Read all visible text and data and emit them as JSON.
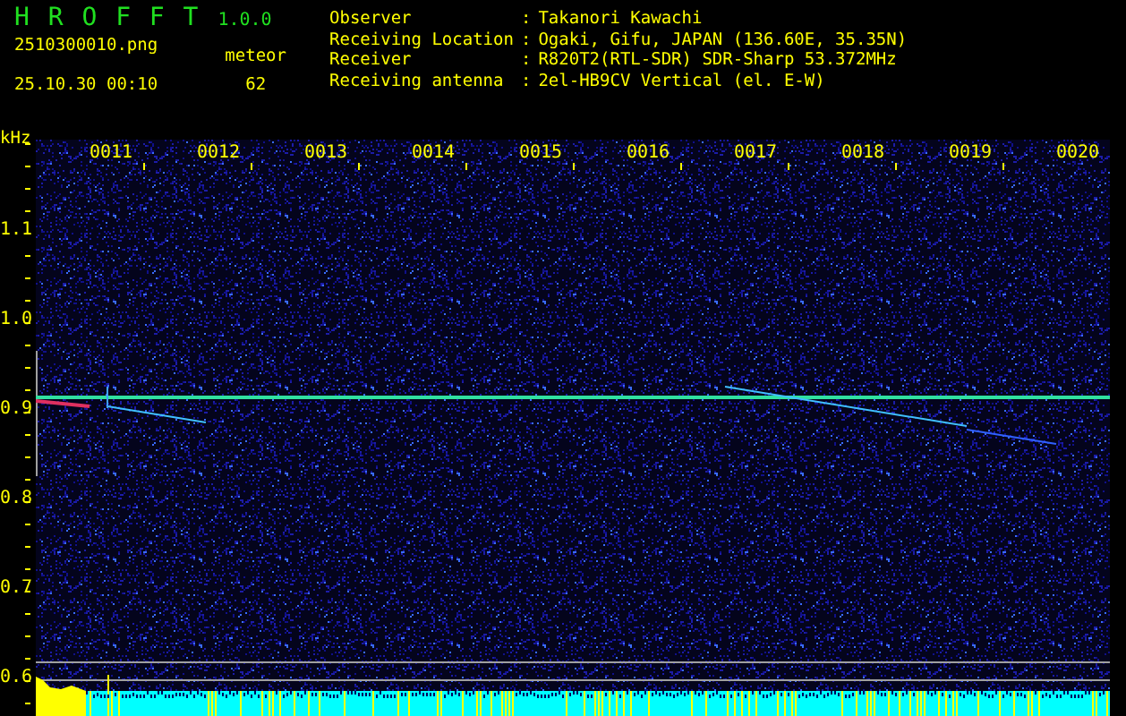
{
  "app": {
    "title": "H R O F F T",
    "version": "1.0.0"
  },
  "file": {
    "name": "2510300010.png",
    "timestamp": "25.10.30 00:10"
  },
  "meteor": {
    "label": "meteor",
    "count": "62"
  },
  "info": [
    {
      "label": "Observer",
      "separator": ":",
      "value": "Takanori Kawachi"
    },
    {
      "label": "Receiving Location",
      "separator": ":",
      "value": "Ogaki, Gifu, JAPAN (136.60E, 35.35N)"
    },
    {
      "label": "Receiver",
      "separator": ":",
      "value": "R820T2(RTL-SDR) SDR-Sharp 53.372MHz"
    },
    {
      "label": "Receiving antenna",
      "separator": ":",
      "value": "2el-HB9CV Vertical (el. E-W)"
    }
  ],
  "spectrogram": {
    "y_unit": "kHz",
    "y_labels": [
      "1.1",
      "1.0",
      "0.9",
      "0.8",
      "0.7",
      "0.6"
    ],
    "time_labels": [
      "0011",
      "0012",
      "0013",
      "0014",
      "0015",
      "0016",
      "0017",
      "0018",
      "0019",
      "0020"
    ]
  }
}
